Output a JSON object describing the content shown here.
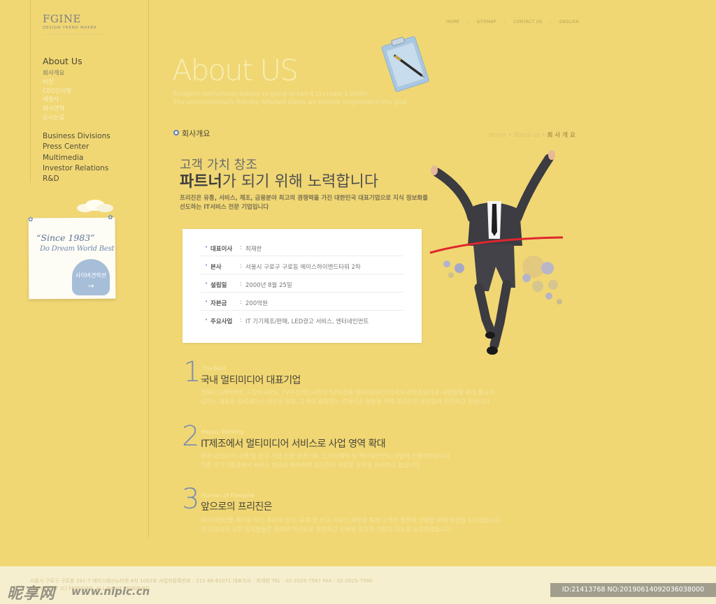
{
  "brand": {
    "name": "FGINE",
    "tagline": "DESIGN TREND MAKER"
  },
  "topnav": {
    "items": [
      "HOME",
      "SITEMAP",
      "CONTACT US",
      "ENGLISH"
    ],
    "separator": "|"
  },
  "sidebar": {
    "section_title": "About Us",
    "submenu": [
      "회사개요",
      "비전",
      "CEO인사말",
      "계열사",
      "회사연혁",
      "오시는길"
    ],
    "menu": [
      "Business Divisions",
      "Press Center",
      "Multimedia",
      "Investor Relations",
      "R&D"
    ]
  },
  "note": {
    "title": "“Since 1983”",
    "subtitle": "Do Dream World Best",
    "button": "사이버견학관",
    "arrow": "→"
  },
  "hero": {
    "title": "About US",
    "line1": "Foragent Instruments kosoes so going to ban it to create a better",
    "line2": "The environmentally friendly Adopted plants we provide longvendere this goal"
  },
  "section": {
    "title": "회사개요",
    "breadcrumb": {
      "home": "Home",
      "sep": "•",
      "mid": "About us",
      "current": "회 사 개 요"
    }
  },
  "intro": {
    "line1": "고객 가치 창조",
    "line2_bold": "파트너",
    "line2_rest": "가 되기 위해 노력합니다",
    "body1": "프리진은 유통, 서비스, 제조, 금융분야 최고의 경쟁력을 가진 대한민국 대표기업으로 지식 정보화를",
    "body2": "선도하는 IT서비스 전문 기업입니다"
  },
  "info": {
    "bullet": "•",
    "colon": ":",
    "rows": [
      {
        "label": "대표이사",
        "value": "최재한"
      },
      {
        "label": "본사",
        "value": "서울시 구로구 구로동 에이스하이엔드타워 2차"
      },
      {
        "label": "설립일",
        "value": "2000년 8월 25일"
      },
      {
        "label": "자본금",
        "value": "200억원"
      },
      {
        "label": "주요사업",
        "value": "IT 기기제조/판매, LED광고 서비스, 엔터네인먼트"
      }
    ]
  },
  "items": [
    {
      "num": "1",
      "sub": "The Best",
      "title": "국내 멀티미디어 대표기업",
      "body1": "컴퓨터그래픽카드 시장의 40%, TV수신카드시장의 50%점유 멀티미디어기기에서 콘텐츠분야로 사업영역 확대 풍요가",
      "body2": "넘치는 새로운 유비쿼터스 세상을 위해, 고객이 감동하는 IT서비스 창출을 위해 프리진은 끊임없이 전진하고 있습니다"
    },
    {
      "num": "2",
      "sub": "Happy Working",
      "title": "IT제조에서 멀티미디어 서비스로 사업 영역 확대",
      "body1": "중국 LED기기 수출 및 광고 사업 진출 공연기획, 드라마제작 및 엔터네인먼트 사업에 진출하였습니다",
      "body2": "기존 IT기기중심에서 서비스 분야로 확대하며 프리진의 새로운 도약을 준비하고 있습니다"
    },
    {
      "num": "3",
      "sub": "Human of Freegine",
      "title": "앞으로의 프리진은",
      "body1": "데이터센터를 계기로 무선 주파수 인식, 유통 등 신규 서비스 제공을 통해 고객의 경쟁력 강화를 위해 최선을 다하겠습니다",
      "body2": "각 자회사의 모든 임직원들은 변화와 혁신으로 무장하고 신뢰와 도약의 기업이 되도록 노력하겠습니다"
    }
  ],
  "footer": {
    "address": "서울시 구로구 구로동 191-7 에이스테크노타워 8차 1002호   사업자등록번호 : 211-86-61071  대표이사 : 최재한     TEL : 02-2025-7587     FAX : 02-2025-7590",
    "copyright": "COPYRIGHT (C) FREEGINE. ALL RIGHT RESERVED."
  },
  "watermark": {
    "left": "昵享网",
    "url": "www.nipic.cn",
    "right": "ID:21413768 NO:20190614092036038000"
  },
  "colors": {
    "background": "#f0d774",
    "accent_blue": "#5c7dc0",
    "ribbon_red": "#e0262e"
  }
}
